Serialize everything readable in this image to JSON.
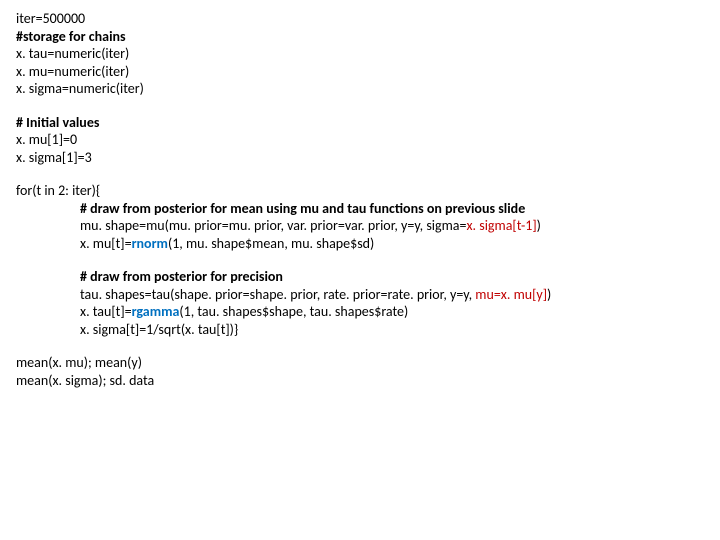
{
  "l1": "iter=500000",
  "l2": "#storage for chains",
  "l3": "x. tau=numeric(iter)",
  "l4": "x. mu=numeric(iter)",
  "l5": "x. sigma=numeric(iter)",
  "l6": "# Initial values",
  "l7": "x. mu[1]=0",
  "l8": "x. sigma[1]=3",
  "l9": "for(t in 2: iter){",
  "l10": "# draw from posterior for mean using mu and tau functions on previous slide",
  "l11a": "mu. shape=mu(mu. prior=mu. prior, var. prior=var. prior, y=y, sigma=",
  "l11b": "x. sigma[t-1]",
  "l11c": ")",
  "l12a": "x. mu[t]=",
  "l12b": "rnorm",
  "l12c": "(1, mu. shape$mean, mu. shape$sd)",
  "l13": "# draw from posterior for precision",
  "l14a": "tau. shapes=tau(shape. prior=shape. prior, rate. prior=rate. prior, y=y, ",
  "l14b": "mu=x. mu[y]",
  "l14c": ")",
  "l15a": "x. tau[t]=",
  "l15b": "rgamma",
  "l15c": "(1, tau. shapes$shape, tau. shapes$rate)",
  "l16": "x. sigma[t]=1/sqrt(x. tau[t])}",
  "l17": "mean(x. mu); mean(y)",
  "l18": "mean(x. sigma); sd. data"
}
